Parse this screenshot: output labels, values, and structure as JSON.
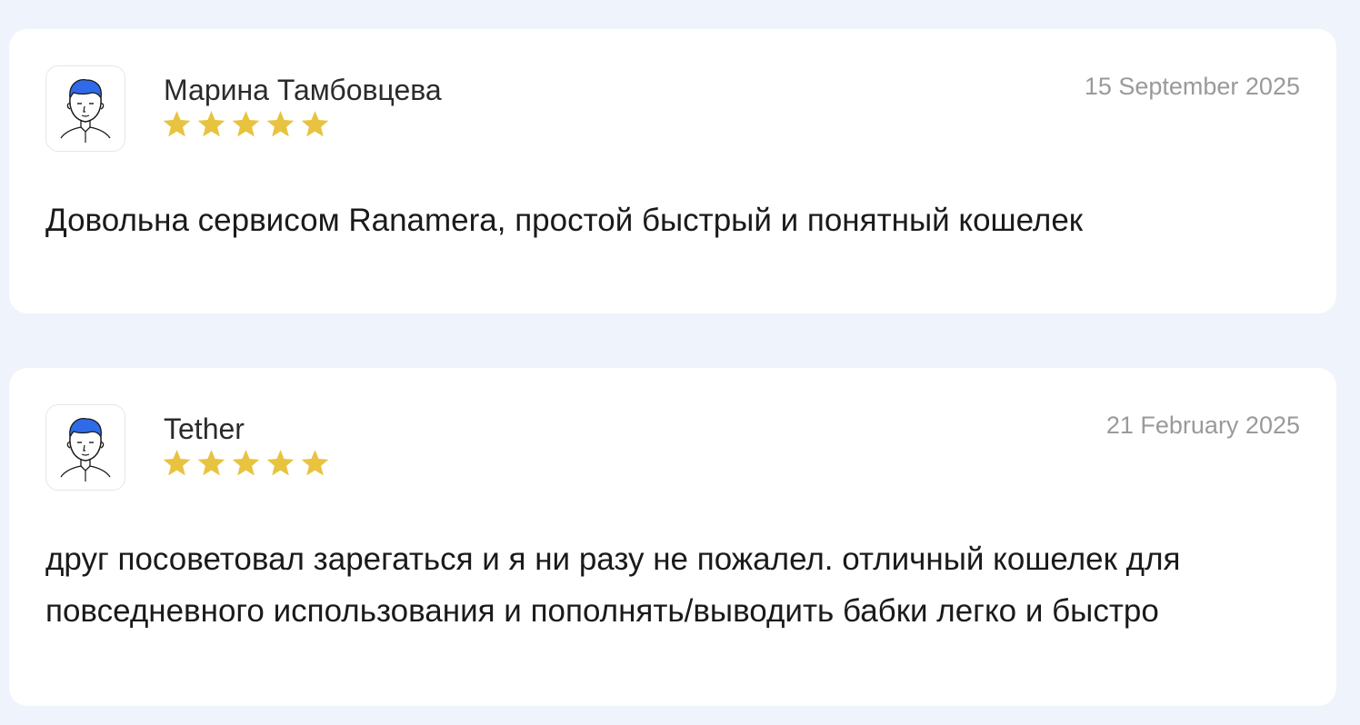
{
  "reviews": [
    {
      "author": "Марина Тамбовцева",
      "date": "15 September 2025",
      "rating": 5,
      "text": "Довольна сервисом Ranamera, простой быстрый и понятный кошелек"
    },
    {
      "author": "Tether",
      "date": "21 February 2025",
      "rating": 5,
      "text": "друг посоветовал зарегаться и я ни разу не пожалел. отличный кошелек для повседневного использования и пополнять/выводить бабки легко и быстро"
    }
  ],
  "icons": {
    "avatar": "user-avatar-icon",
    "star": "star-icon"
  },
  "colors": {
    "background": "#eff3fb",
    "card": "#ffffff",
    "star": "#e8c33f",
    "hair": "#2f6be8",
    "date_text": "#9a9a9a"
  }
}
